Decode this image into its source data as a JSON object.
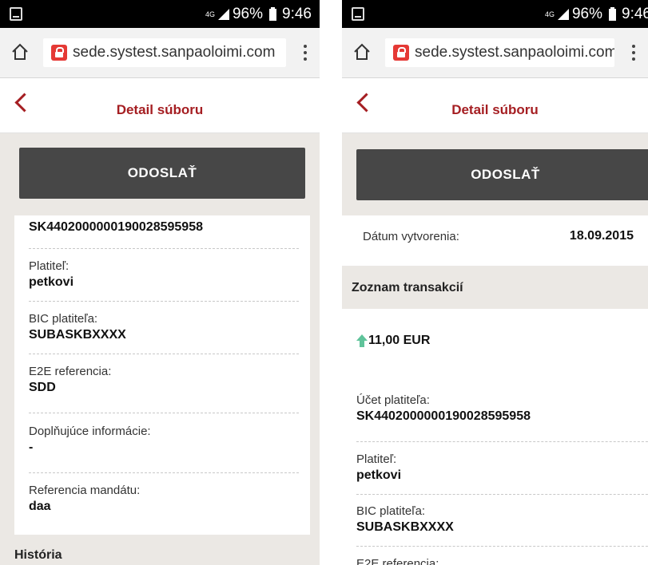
{
  "browser": {
    "status_network": "4G",
    "status_battery": "96%",
    "status_time": "9:46",
    "url": "sede.systest.sanpaoloimi.com"
  },
  "header": {
    "title": "Detail súboru"
  },
  "actions": {
    "send_label": "ODOSLAŤ"
  },
  "left": {
    "account_value": "SK4402000000190028595958",
    "fields": [
      {
        "label": "Platiteľ:",
        "value": "petkovi"
      },
      {
        "label": "BIC platiteľa:",
        "value": "SUBASKBXXXX"
      },
      {
        "label": "E2E referencia:",
        "value": "SDD"
      },
      {
        "label": "Doplňujúce informácie:",
        "value": "-"
      },
      {
        "label": "Referencia mandátu:",
        "value": "daa"
      }
    ],
    "history_title": "História"
  },
  "right": {
    "created_label": "Dátum vytvorenia:",
    "created_value": "18.09.2015",
    "transactions_title": "Zoznam transakcií",
    "transaction_amount": "11,00 EUR",
    "fields": [
      {
        "label": "Účet platiteľa:",
        "value": "SK4402000000190028595958"
      },
      {
        "label": "Platiteľ:",
        "value": "petkovi"
      },
      {
        "label": "BIC platiteľa:",
        "value": "SUBASKBXXXX"
      },
      {
        "label": "E2E referencia:",
        "value": ""
      }
    ]
  },
  "colors": {
    "brand": "#a51e22",
    "button": "#474747",
    "arrow_up": "#5fc39a"
  }
}
